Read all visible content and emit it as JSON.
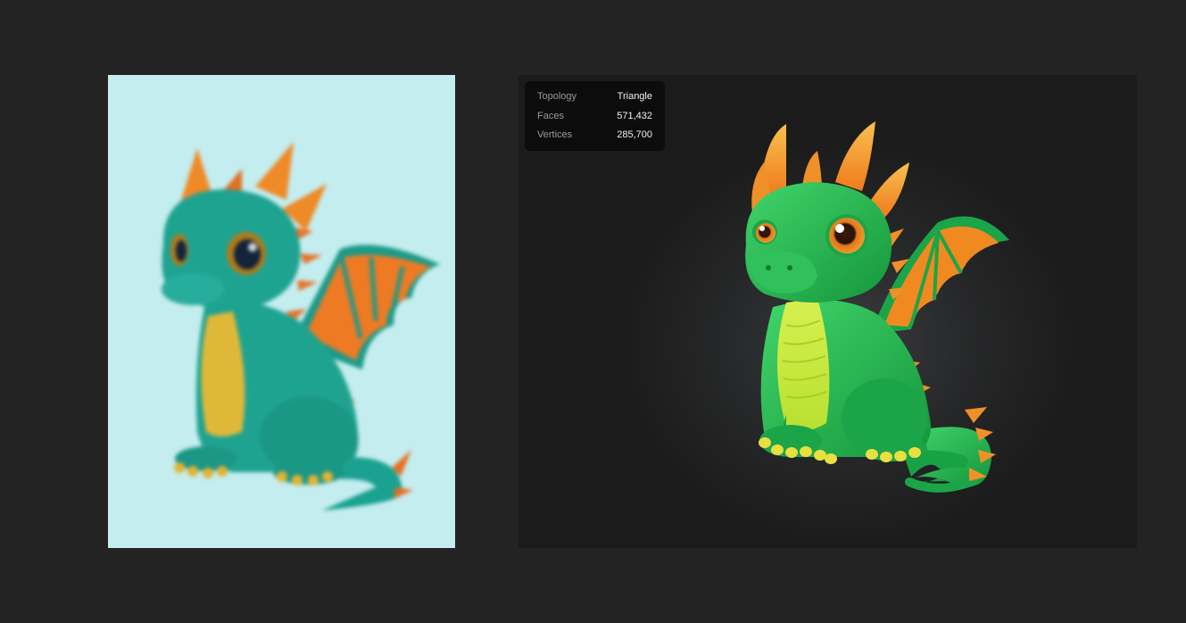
{
  "stats": [
    {
      "label": "Topology",
      "value": "Triangle"
    },
    {
      "label": "Faces",
      "value": "571,432"
    },
    {
      "label": "Vertices",
      "value": "285,700"
    }
  ],
  "colors": {
    "background": "#232323",
    "input_bg": "#c4edef",
    "viewport_bg": "#1b1b1b",
    "input_body": "#1fa391",
    "input_belly": "#e0b838",
    "model_body": "#21b14f",
    "model_belly": "#c8e838",
    "accent": "#f08a1e"
  },
  "icons": {
    "input_image": "baby-dragon-illustration",
    "render": "baby-dragon-3d-render"
  }
}
